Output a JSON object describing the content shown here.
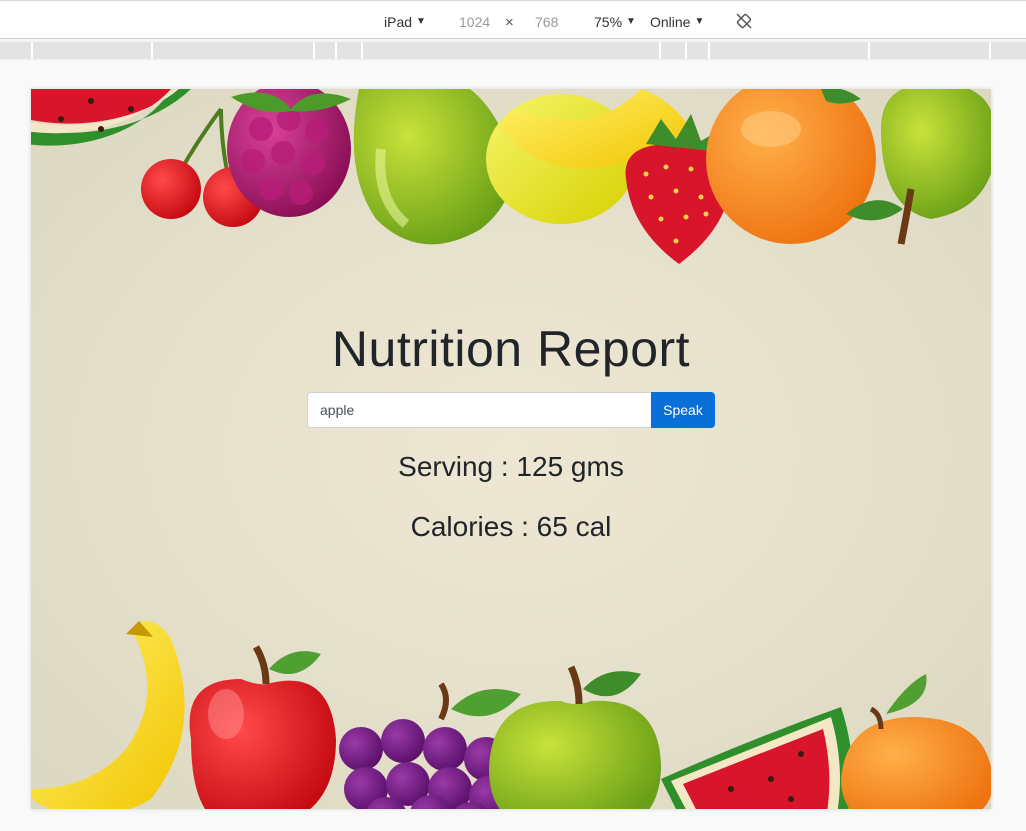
{
  "devtools": {
    "device": "iPad",
    "width": "1024",
    "separator": "×",
    "height": "768",
    "zoom": "75%",
    "throttle": "Online",
    "rotate_icon": "rotate-icon"
  },
  "page": {
    "title": "Nutrition Report",
    "search": {
      "value": "apple"
    },
    "speak_label": "Speak",
    "serving": "Serving : 125 gms",
    "calories": "Calories : 65 cal"
  }
}
